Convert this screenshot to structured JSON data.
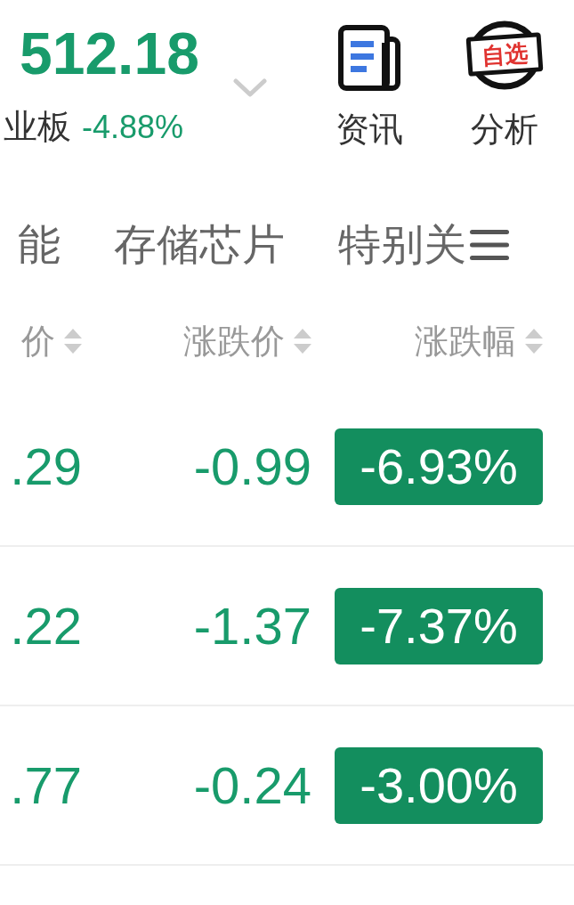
{
  "index": {
    "value": "512.18",
    "name": "业板",
    "change": "-4.88%"
  },
  "actions": [
    {
      "kind": "news",
      "label": "资讯"
    },
    {
      "kind": "watchlist",
      "label": "分析",
      "tag": "自选"
    }
  ],
  "tabs": [
    {
      "label": "能",
      "selected": false
    },
    {
      "label": "存储芯片",
      "selected": false
    },
    {
      "label": "特别关",
      "selected": false
    }
  ],
  "columns": [
    {
      "label": "价"
    },
    {
      "label": "涨跌价"
    },
    {
      "label": "涨跌幅"
    }
  ],
  "rows": [
    {
      "price": ".29",
      "change": "-0.99",
      "percent": "-6.93%"
    },
    {
      "price": ".22",
      "change": "-1.37",
      "percent": "-7.37%"
    },
    {
      "price": ".77",
      "change": "-0.24",
      "percent": "-3.00%"
    }
  ]
}
